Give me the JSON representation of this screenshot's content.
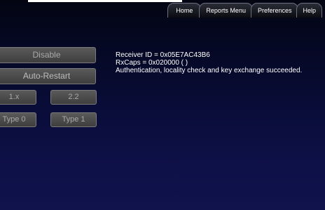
{
  "nav": {
    "tabs": [
      {
        "label": "Home"
      },
      {
        "label": "Reports Menu"
      },
      {
        "label": "Preferences"
      },
      {
        "label": "Help"
      }
    ]
  },
  "controls": {
    "disable_label": "Disable",
    "auto_restart_label": "Auto-Restart",
    "version_1x_label": "1.x",
    "version_22_label": "2.2",
    "type0_label": "Type 0",
    "type1_label": "Type 1"
  },
  "status": {
    "receiver_id": "Receiver ID = 0x05E7AC43B6",
    "rxcaps": "RxCaps = 0x020000 ( )",
    "result": "Authentication, locality check and key exchange succeeded."
  }
}
